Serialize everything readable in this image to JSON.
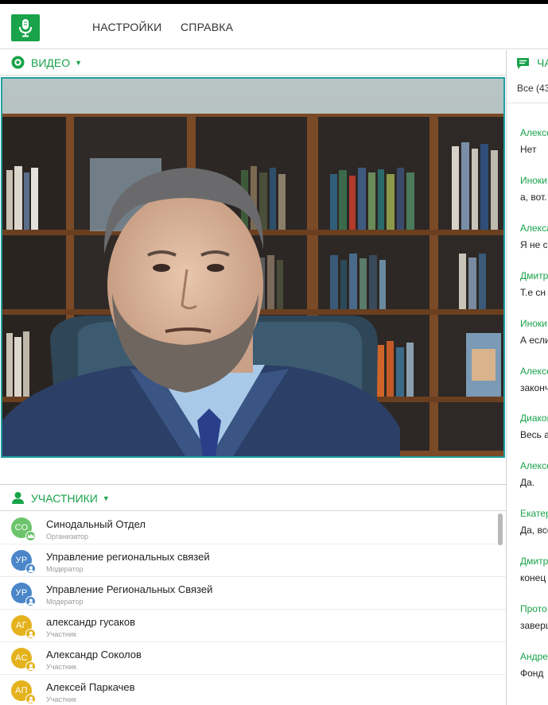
{
  "header": {
    "nav": [
      "НАСТРОЙКИ",
      "СПРАВКА"
    ]
  },
  "video_panel": {
    "title": "ВИДЕО"
  },
  "participants_panel": {
    "title": "УЧАСТНИКИ",
    "items": [
      {
        "initials": "СО",
        "name": "Синодальный Отдел",
        "role": "Организатор",
        "color": "#6cc46c",
        "badge": "crown"
      },
      {
        "initials": "УР",
        "name": "Управление региональных связей",
        "role": "Модератор",
        "color": "#4a86c8",
        "badge": "person"
      },
      {
        "initials": "УР",
        "name": "Управление Региональных Связей",
        "role": "Модератор",
        "color": "#4a86c8",
        "badge": "person"
      },
      {
        "initials": "АГ",
        "name": "александр гусаков",
        "role": "Участник",
        "color": "#e4b21c",
        "badge": "person"
      },
      {
        "initials": "АС",
        "name": "Александр Соколов",
        "role": "Участник",
        "color": "#e4b21c",
        "badge": "person"
      },
      {
        "initials": "АП",
        "name": "Алексей Паркачев",
        "role": "Участник",
        "color": "#e4b21c",
        "badge": "person"
      }
    ]
  },
  "chat_panel": {
    "title": "ЧА",
    "filter": "Все (43",
    "messages": [
      {
        "author": "Алексе",
        "text": "Нет"
      },
      {
        "author": "Иноки",
        "text": "а, вот."
      },
      {
        "author": "Алекса",
        "text": "Я не с"
      },
      {
        "author": "Дмитр",
        "text": "Т.е сн"
      },
      {
        "author": "Иноки",
        "text": "А если"
      },
      {
        "author": "Алексе",
        "text": "законч"
      },
      {
        "author": "Диакон",
        "text": "Весь а"
      },
      {
        "author": "Алексе",
        "text": "Да."
      },
      {
        "author": "Екатер",
        "text": "Да, все"
      },
      {
        "author": "Дмитр",
        "text": "конец"
      },
      {
        "author": "Прото",
        "text": "заверш"
      },
      {
        "author": "Андре",
        "text": "Фонд"
      }
    ]
  },
  "colors": {
    "accent": "#19a34a",
    "video_border": "#1fa0a0"
  }
}
